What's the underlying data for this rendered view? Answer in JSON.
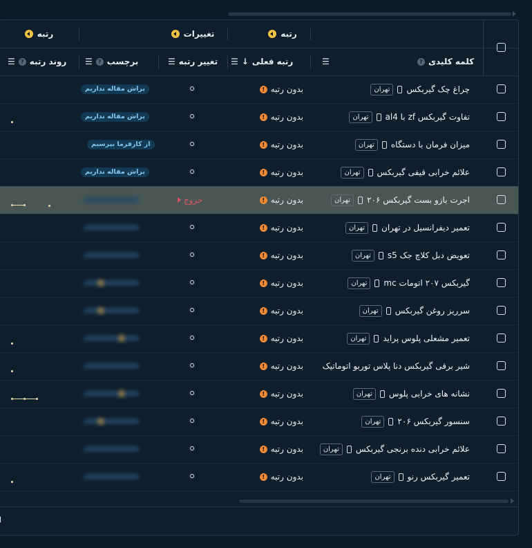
{
  "groups": {
    "rank": "رتبه",
    "changes": "تغییرات",
    "rank_right": "رتبه"
  },
  "columns": {
    "keyword": "کلمه کلیدی",
    "current_rank": "رتبه فعلی",
    "rank_change": "تغییر رتبه",
    "label": "برچسب",
    "rank_trend": "روند رتبه"
  },
  "status": {
    "no_rank": "بدون رتبه",
    "exit": "خروج"
  },
  "location_chip": "تهران",
  "tags": {
    "no_article": "براش مقاله نداریم",
    "ask_employer": "از کارفرما بپرسیم"
  },
  "colors": {
    "background": "#0c1a27",
    "highlight_row": "#495653",
    "warning": "#ef8a32",
    "exit": "#e35565",
    "tag_bg": "#123a55",
    "tag_text": "#7fc4ee"
  },
  "rows": [
    {
      "keyword": "چراغ چک گیربکس",
      "tag": "براش مقاله نداریم"
    },
    {
      "keyword": "تفاوت گیربکس zf با al4",
      "tag": "براش مقاله نداریم"
    },
    {
      "keyword": "میزان فرمان با دستگاه",
      "tag": "از کارفرما بپرسیم"
    },
    {
      "keyword": "علائم خرابی قیفی گیربکس",
      "tag": "براش مقاله نداریم"
    },
    {
      "keyword": "اجرت بازو بست گیربکس ۲۰۶",
      "tag": ""
    },
    {
      "keyword": "تعمیر دیفرانسیل در تهران",
      "tag": ""
    },
    {
      "keyword": "تعویض دبل کلاچ جک s5",
      "tag": ""
    },
    {
      "keyword": "گیربکس ۲۰۷ اتومات mc",
      "tag": ""
    },
    {
      "keyword": "سرریز روغن گیربکس",
      "tag": ""
    },
    {
      "keyword": "تعمیر مشعلی پلوس پراید",
      "tag": ""
    },
    {
      "keyword": "شیر برقی گیربکس دنا پلاس توربو اتوماتیک",
      "tag": ""
    },
    {
      "keyword": "نشانه های خرابی پلوس",
      "tag": ""
    },
    {
      "keyword": "سنسور گیربکس ۲۰۶",
      "tag": ""
    },
    {
      "keyword": "علائم خرابی دنده برنجی گیربکس",
      "tag": ""
    },
    {
      "keyword": "تعمیر گیربکس رنو",
      "tag": ""
    }
  ],
  "footer": {
    "text": "ا"
  }
}
